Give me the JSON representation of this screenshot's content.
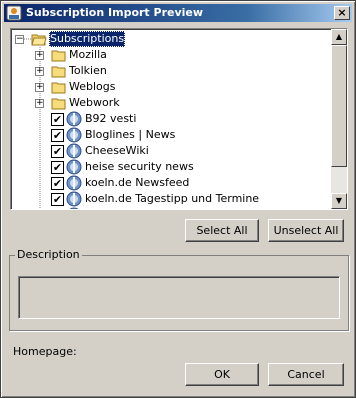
{
  "window": {
    "title": "Subscription Import Preview",
    "close_label": "×"
  },
  "tree": {
    "root": {
      "label": "Subscriptions",
      "expander": "−"
    },
    "folders": [
      {
        "label": "Mozilla",
        "expander": "+"
      },
      {
        "label": "Tolkien",
        "expander": "+"
      },
      {
        "label": "Weblogs",
        "expander": "+"
      },
      {
        "label": "Webwork",
        "expander": "+"
      }
    ],
    "feeds": [
      {
        "label": "B92 vesti",
        "checked": "✔"
      },
      {
        "label": "Bloglines | News",
        "checked": "✔"
      },
      {
        "label": "CheeseWiki",
        "checked": "✔"
      },
      {
        "label": "heise security news",
        "checked": "✔"
      },
      {
        "label": "koeln.de Newsfeed",
        "checked": "✔"
      },
      {
        "label": "koeln.de Tagestipp und Termine",
        "checked": "✔"
      },
      {
        "label": "",
        "checked": "✔"
      }
    ],
    "scroll_up": "▲",
    "scroll_down": "▼"
  },
  "buttons": {
    "select_all": "Select All",
    "unselect_all": "Unselect All",
    "ok": "OK",
    "cancel": "Cancel"
  },
  "description": {
    "label": "Description",
    "value": ""
  },
  "homepage": {
    "label": "Homepage:"
  }
}
